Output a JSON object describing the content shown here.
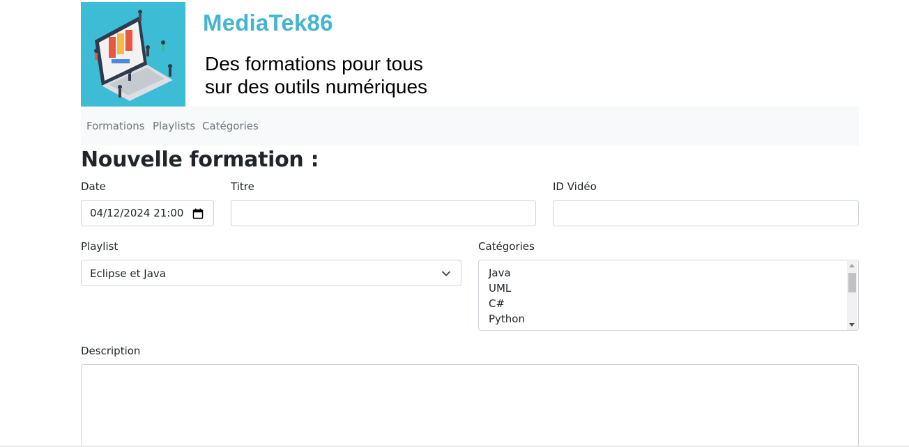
{
  "header": {
    "site_title": "MediaTek86",
    "tagline_line1": "Des formations pour tous",
    "tagline_line2": "sur des outils numériques",
    "logo_icon": "laptop-people-illustration-icon",
    "brand_color": "#45b4cf"
  },
  "nav": {
    "items": [
      {
        "label": "Formations"
      },
      {
        "label": "Playlists"
      },
      {
        "label": "Catégories"
      }
    ]
  },
  "page": {
    "title": "Nouvelle formation :"
  },
  "form": {
    "date": {
      "label": "Date",
      "value": "04/12/2024 21:00"
    },
    "titre": {
      "label": "Titre",
      "value": ""
    },
    "video_id": {
      "label": "ID Vidéo",
      "value": ""
    },
    "playlist": {
      "label": "Playlist",
      "selected": "Eclipse et Java"
    },
    "categories": {
      "label": "Catégories",
      "options": [
        "Java",
        "UML",
        "C#",
        "Python"
      ]
    },
    "description": {
      "label": "Description",
      "value": ""
    }
  }
}
